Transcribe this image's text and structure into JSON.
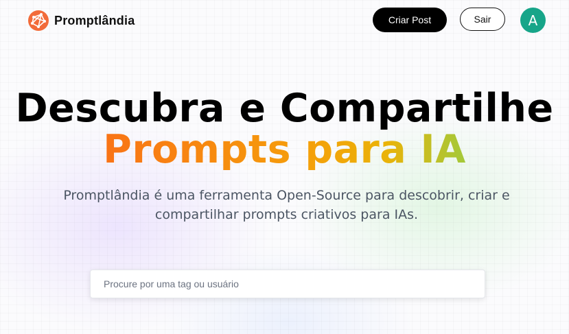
{
  "header": {
    "brand_name": "Promptlândia",
    "logo_icon": "globe-network-icon",
    "create_post_label": "Criar Post",
    "logout_label": "Sair",
    "avatar_initial": "A"
  },
  "hero": {
    "title_line1": "Descubra e Compartilhe",
    "title_line2": "Prompts para IA",
    "description": "Promptlândia é uma ferramenta Open-Source para descobrir, criar e compartilhar prompts criativos para IAs."
  },
  "search": {
    "value": "",
    "placeholder": "Procure por uma tag ou usuário"
  },
  "colors": {
    "accent_gradient": [
      "#f97316",
      "#f59e0b",
      "#eab308",
      "#a3c93a"
    ],
    "avatar_bg": "#17a589",
    "logo": "#f26b3a",
    "primary_button": "#000000"
  }
}
